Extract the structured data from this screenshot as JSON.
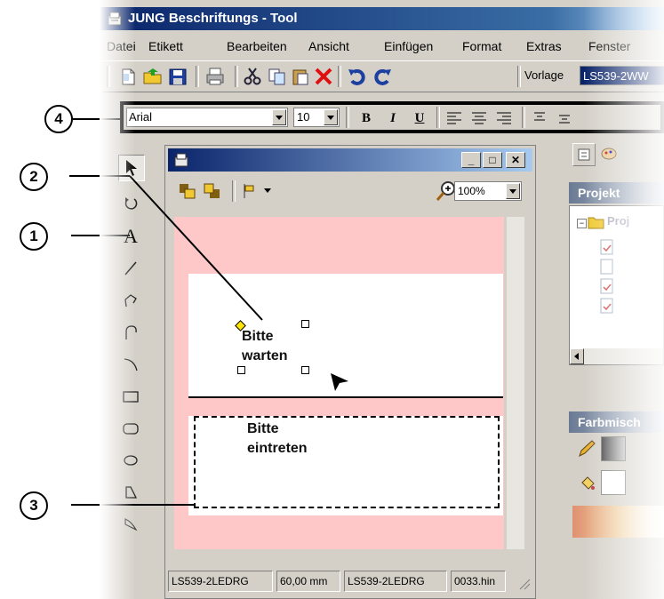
{
  "app": {
    "title": "JUNG Beschriftungs - Tool"
  },
  "menu": [
    "Datei",
    "Etikett",
    "Bearbeiten",
    "Ansicht",
    "Einfügen",
    "Format",
    "Extras",
    "Fenster"
  ],
  "toolbar": {
    "vorlage_label": "Vorlage",
    "vorlage_value": "LS539-2WW"
  },
  "format_bar": {
    "font": "Arial",
    "size": "10",
    "bold": "B",
    "italic": "I",
    "underline": "U"
  },
  "doc_window": {
    "zoom": "100%"
  },
  "labels": {
    "label1": [
      "Bitte",
      "warten"
    ],
    "label2": [
      "Bitte",
      "eintreten"
    ]
  },
  "status": [
    "LS539-2LEDRG",
    "60,00 mm",
    "LS539-2LEDRG",
    "0033.hin"
  ],
  "right_panel": {
    "projekt_header": "Projekt",
    "tree_root": "Proj",
    "farb_header": "Farbmisch"
  },
  "callouts": [
    "1",
    "2",
    "3",
    "4"
  ],
  "colors": {
    "title_dark": "#0a246a",
    "title_light": "#a6caf0",
    "canvas_pink": "#ffc8c8",
    "chrome": "#d4d0c8",
    "handle_yellow": "#ffe600"
  }
}
